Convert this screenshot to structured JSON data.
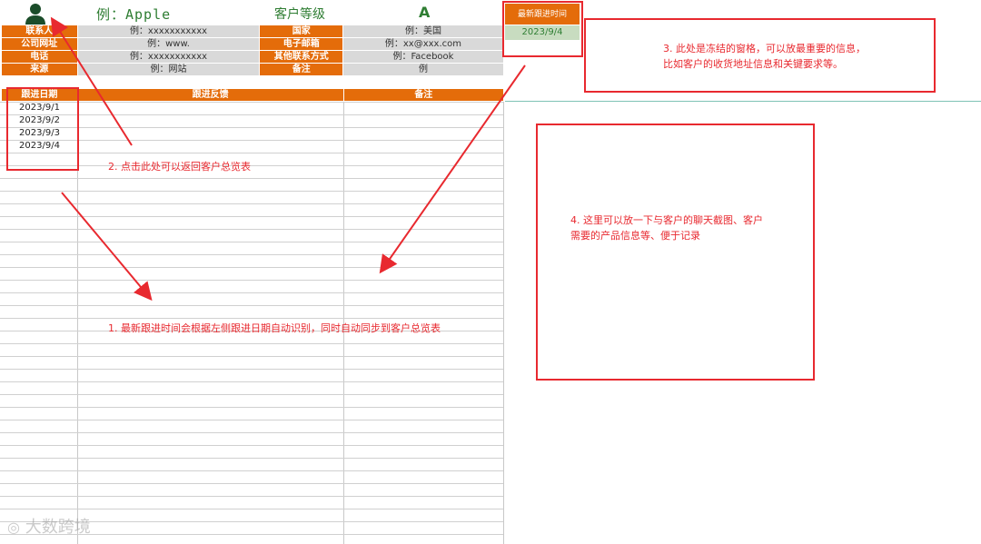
{
  "header": {
    "name_value": "例：Apple",
    "level_label": "客户等级",
    "level_value": "A"
  },
  "info_rows": [
    {
      "label1": "联系人",
      "value1": "例：xxxxxxxxxxx",
      "label2": "国家",
      "value2": "例：美国"
    },
    {
      "label1": "公司网址",
      "value1": "例：www.",
      "label2": "电子邮箱",
      "value2": "例：xx@xxx.com"
    },
    {
      "label1": "电话",
      "value1": "例：xxxxxxxxxxx",
      "label2": "其他联系方式",
      "value2": "例：Facebook"
    },
    {
      "label1": "来源",
      "value1": "例：网站",
      "label2": "备注",
      "value2": "例"
    }
  ],
  "latest": {
    "label": "最新跟进时间",
    "value": "2023/9/4"
  },
  "table": {
    "headers": [
      "跟进日期",
      "跟进反馈",
      "备注"
    ],
    "dates": [
      "2023/9/1",
      "2023/9/2",
      "2023/9/3",
      "2023/9/4"
    ]
  },
  "annotations": {
    "a1": "1. 最新跟进时间会根据左侧跟进日期自动识别，同时自动同步到客户总览表",
    "a2": "2. 点击此处可以返回客户总览表",
    "a3_line1": "3. 此处是冻结的窗格，可以放最重要的信息，",
    "a3_line2": "比如客户的收货地址信息和关键要求等。",
    "a4_line1": "4. 这里可以放一下与客户的聊天截图、客户",
    "a4_line2": "需要的产品信息等、便于记录"
  },
  "watermark": "大数跨境",
  "colors": {
    "orange": "#e46c0a",
    "red": "#e8292f",
    "green": "#2e7d32",
    "gray": "#d9d9d9"
  }
}
